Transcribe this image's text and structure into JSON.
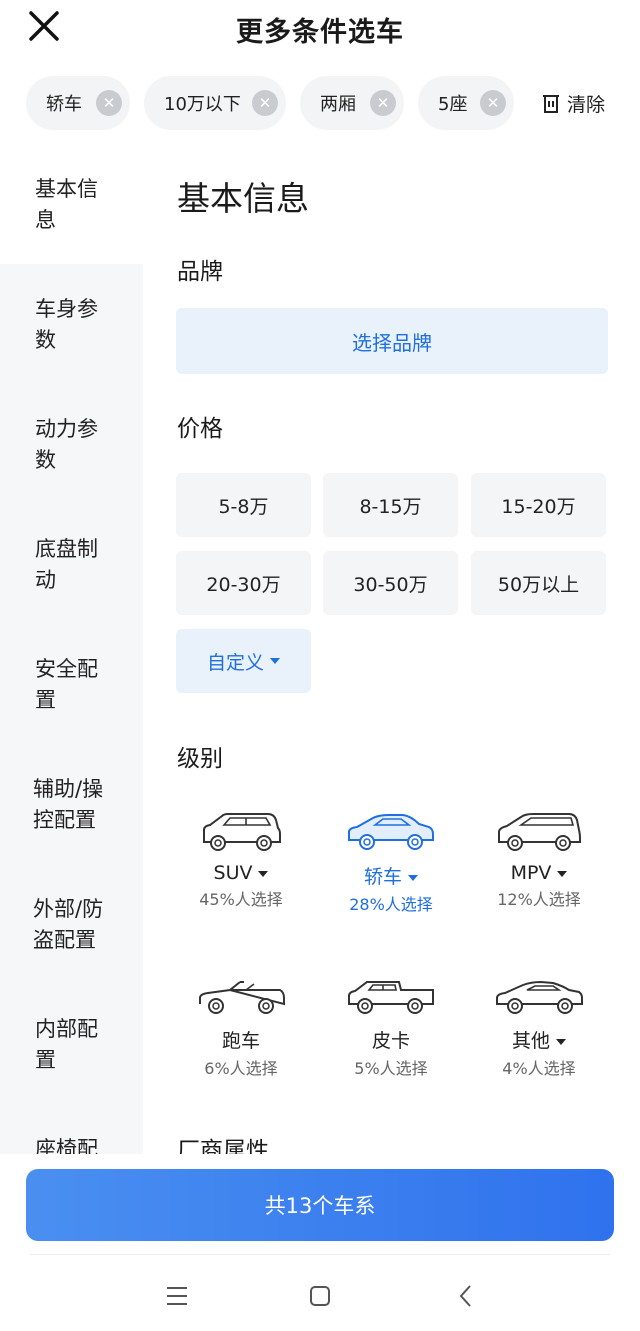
{
  "header": {
    "title": "更多条件选车"
  },
  "chips": [
    {
      "label": "轿车"
    },
    {
      "label": "10万以下"
    },
    {
      "label": "两厢"
    },
    {
      "label": "5座"
    }
  ],
  "clear_label": "清除",
  "sidebar": {
    "items": [
      {
        "label": "基本信息"
      },
      {
        "label": "车身参数"
      },
      {
        "label": "动力参数"
      },
      {
        "label": "底盘制动"
      },
      {
        "label": "安全配置"
      },
      {
        "label": "辅助/操控配置"
      },
      {
        "label": "外部/防盗配置"
      },
      {
        "label": "内部配置"
      },
      {
        "label": "座椅配"
      }
    ]
  },
  "content": {
    "heading": "基本信息",
    "brand": {
      "label": "品牌",
      "button": "选择品牌"
    },
    "price": {
      "label": "价格",
      "options": [
        "5-8万",
        "8-15万",
        "15-20万",
        "20-30万",
        "30-50万",
        "50万以上"
      ],
      "custom": "自定义"
    },
    "level": {
      "label": "级别",
      "items": [
        {
          "name": "SUV",
          "pct": "45%人选择",
          "icon": "suv-icon",
          "dropdown": true
        },
        {
          "name": "轿车",
          "pct": "28%人选择",
          "icon": "sedan-icon",
          "dropdown": true
        },
        {
          "name": "MPV",
          "pct": "12%人选择",
          "icon": "mpv-icon",
          "dropdown": true
        },
        {
          "name": "跑车",
          "pct": "6%人选择",
          "icon": "sports-car-icon",
          "dropdown": false
        },
        {
          "name": "皮卡",
          "pct": "5%人选择",
          "icon": "pickup-icon",
          "dropdown": false
        },
        {
          "name": "其他",
          "pct": "4%人选择",
          "icon": "other-car-icon",
          "dropdown": true
        }
      ]
    },
    "maker": {
      "label": "厂商属性"
    }
  },
  "cta": {
    "label": "共13个车系"
  },
  "colors": {
    "accent": "#1f6fe0",
    "cta_start": "#4a8ff0",
    "cta_end": "#2f72ee"
  }
}
